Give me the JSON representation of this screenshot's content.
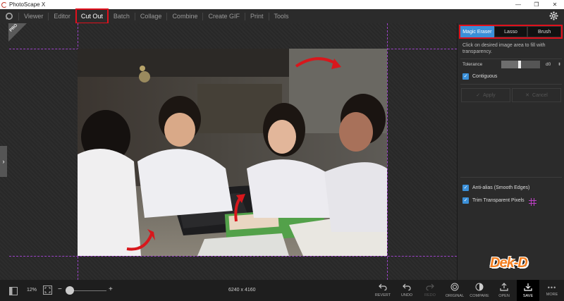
{
  "window": {
    "title": "PhotoScape X",
    "minimize": "—",
    "maximize": "❐",
    "close": "✕"
  },
  "menu": {
    "items": [
      "Viewer",
      "Editor",
      "Cut Out",
      "Batch",
      "Collage",
      "Combine",
      "Create GIF",
      "Print",
      "Tools"
    ],
    "active": "Cut Out"
  },
  "canvas": {
    "pro_badge": "PRO",
    "side_handle": "›"
  },
  "panel": {
    "tabs": [
      {
        "label": "Magic Eraser",
        "active": true
      },
      {
        "label": "Lasso",
        "active": false
      },
      {
        "label": "Brush",
        "active": false
      }
    ],
    "hint": "Click on desired image area to fill with transparency.",
    "tolerance_label": "Tolerance",
    "tolerance_value": "d0",
    "tolerance_level": 0.48,
    "contiguous_label": "Contiguous",
    "contiguous_checked": true,
    "apply_label": "Apply",
    "cancel_label": "Cancel",
    "antialias_label": "Anti-alias (Smooth Edges)",
    "antialias_checked": true,
    "trim_label": "Trim Transparent Pixels",
    "trim_checked": true
  },
  "bottom": {
    "zoom": "12%",
    "zoom_minus": "−",
    "zoom_plus": "+",
    "zoom_level": 0.12,
    "dimensions": "6240 x 4160",
    "actions": [
      "REVERT",
      "UNDO",
      "REDO",
      "ORIGINAL",
      "COMPARE",
      "OPEN",
      "SAVE",
      "MORE"
    ]
  },
  "watermark": "Dek-D",
  "colors": {
    "accent": "#3a8fd8",
    "highlight_box": "#e0101c",
    "guide": "#9c42c8",
    "arrow": "#d8171c"
  }
}
